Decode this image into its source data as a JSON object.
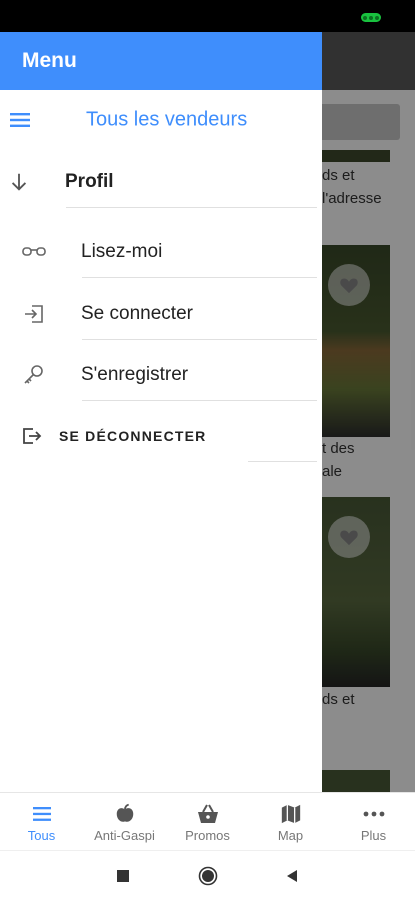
{
  "drawer": {
    "title": "Menu",
    "items": [
      {
        "label": "Tous les vendeurs",
        "icon": "list-icon"
      },
      {
        "label": "Profil",
        "icon": "arrow-down-icon"
      },
      {
        "label": "Lisez-moi",
        "icon": "glasses-icon"
      },
      {
        "label": "Se connecter",
        "icon": "login-icon"
      },
      {
        "label": "S'enregistrer",
        "icon": "key-icon"
      },
      {
        "label": "SE DÉCONNECTER",
        "icon": "logout-icon"
      }
    ]
  },
  "background": {
    "texts": [
      "ds et",
      "l'adresse",
      "t des",
      "ale",
      "ds et"
    ]
  },
  "bottom_nav": {
    "items": [
      {
        "label": "Tous",
        "icon": "list-icon",
        "active": true
      },
      {
        "label": "Anti-Gaspi",
        "icon": "apple-icon"
      },
      {
        "label": "Promos",
        "icon": "basket-icon"
      },
      {
        "label": "Map",
        "icon": "map-icon"
      },
      {
        "label": "Plus",
        "icon": "more-icon"
      }
    ]
  },
  "colors": {
    "accent": "#3f8efc",
    "battery": "#19c23f"
  }
}
